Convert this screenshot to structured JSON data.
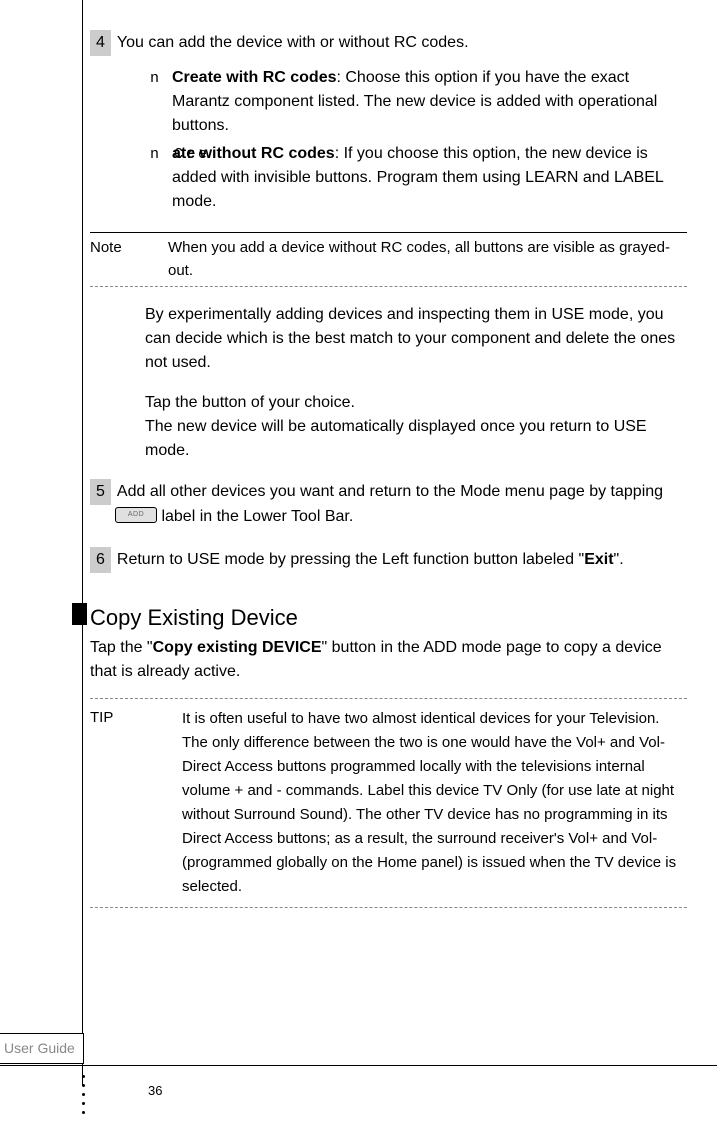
{
  "step4": {
    "num": "4",
    "intro": "You can add the device with or without RC codes.",
    "bullet1_marker": "n",
    "bullet1_bold": "Create with RC codes",
    "bullet1_rest": ": Choose this option if you have the exact Marantz component listed. The new device is added with operational buttons.",
    "bullet2_marker": "n Cre",
    "bullet2_bold": "ate without RC codes",
    "bullet2_rest": ": If you choose this option, the new device is added with invisible buttons. Program them using LEARN and LABEL mode."
  },
  "note": {
    "label": "Note",
    "text": "When you add a device without RC codes, all buttons are visible as grayed-out."
  },
  "para1": "By experimentally adding devices and inspecting them in USE mode, you can decide which is the best match to your component and delete the ones not used.",
  "para2a": "Tap the button of your choice.",
  "para2b": "The new device will be automatically displayed once you return to USE mode.",
  "step5": {
    "num": "5",
    "text_a": "Add all other devices you want and return to the Mode menu page by tapping ",
    "text_b": " label in the Lower Tool Bar."
  },
  "step6": {
    "num": "6",
    "text_a": "Return to USE mode by pressing the Left function button labeled \"",
    "bold": "Exit",
    "text_b": "\"."
  },
  "heading": "Copy Existing Device",
  "subheading_a": "Tap the \"",
  "subheading_bold": "Copy existing DEVICE",
  "subheading_b": "\" button in the ADD mode page to copy a device that is already active.",
  "tip": {
    "label": "TIP",
    "text": "It is often useful to have two almost identical devices for your Television. The only difference between the two is one would have the Vol+ and Vol- Direct Access buttons programmed locally with the televisions internal volume + and - commands. Label this device TV Only (for use late at night without Surround Sound). The other TV device has no programming in its Direct Access buttons; as a result, the surround receiver's Vol+ and Vol- (programmed globally on the Home panel) is issued when the TV device is selected."
  },
  "footer": {
    "guide": "User Guide",
    "page": "36"
  }
}
